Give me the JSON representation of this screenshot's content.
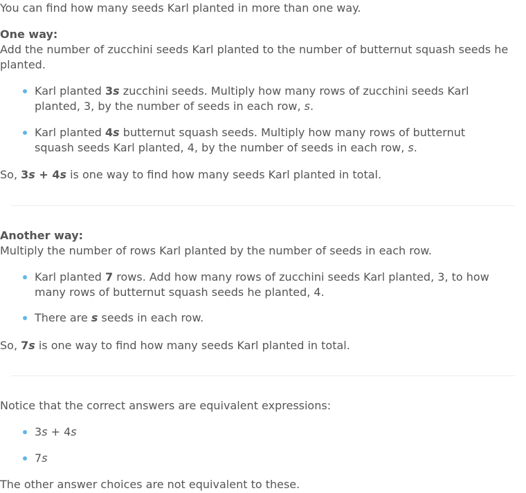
{
  "intro": "You can find how many seeds Karl planted in more than one way.",
  "one_way": {
    "heading": "One way:",
    "desc": "Add the number of zucchini seeds Karl planted to the number of butternut squash seeds he planted.",
    "bullets": [
      {
        "pre": "Karl planted ",
        "bold_num": "3",
        "bold_var": "s",
        "post": " zucchini seeds. Multiply how many rows of zucchini seeds Karl planted, 3, by the number of seeds in each row, ",
        "var": "s",
        "end": "."
      },
      {
        "pre": "Karl planted ",
        "bold_num": "4",
        "bold_var": "s",
        "post": " butternut squash seeds. Multiply how many rows of butternut squash seeds Karl planted, 4, by the number of seeds in each row, ",
        "var": "s",
        "end": "."
      }
    ],
    "conclusion": {
      "pre": "So, ",
      "expr_a_num": "3",
      "expr_a_var": "s",
      "expr_op": " + ",
      "expr_b_num": "4",
      "expr_b_var": "s",
      "post": " is one way to find how many seeds Karl planted in total."
    }
  },
  "another_way": {
    "heading": "Another way:",
    "desc": "Multiply the number of rows Karl planted by the number of seeds in each row.",
    "bullets": [
      {
        "pre": "Karl planted ",
        "bold": "7",
        "post": " rows. Add how many rows of zucchini seeds Karl planted, 3, to how many rows of butternut squash seeds he planted, 4."
      },
      {
        "pre": "There are ",
        "bold_var": "s",
        "post": " seeds in each row."
      }
    ],
    "conclusion": {
      "pre": "So, ",
      "expr_num": "7",
      "expr_var": "s",
      "post": " is one way to find how many seeds Karl planted in total."
    }
  },
  "notice": {
    "text": "Notice that the correct answers are equivalent expressions:",
    "answers": [
      {
        "a_num": "3",
        "a_var": "s",
        "op": " + ",
        "b_num": "4",
        "b_var": "s"
      },
      {
        "num": "7",
        "var": "s"
      }
    ],
    "closing": "The other answer choices are not equivalent to these."
  },
  "colors": {
    "text": "#555555",
    "bullet": "#5fb6e8",
    "divider": "#ececec"
  }
}
